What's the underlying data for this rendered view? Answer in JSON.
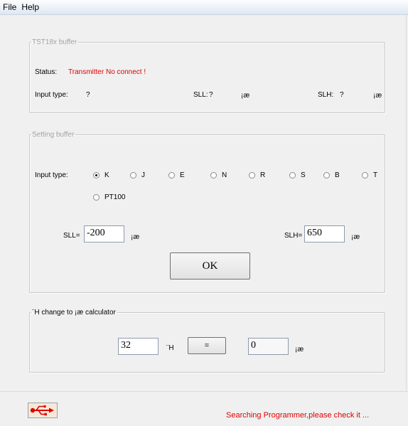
{
  "menu": {
    "file": "File",
    "help": "Help"
  },
  "buffer_group": {
    "legend": "TST18x buffer",
    "status_label": "Status:",
    "status_value": "Transmitter No connect !",
    "input_type_label": "Input type:",
    "input_type_value": "?",
    "sll_label": "SLL:",
    "sll_value": "?",
    "sll_unit": "¡æ",
    "slh_label": "SLH:",
    "slh_value": "?",
    "slh_unit": "¡æ"
  },
  "setting_group": {
    "legend": "Setting buffer",
    "input_type_label": "Input type:",
    "options": [
      "K",
      "J",
      "E",
      "N",
      "R",
      "S",
      "B",
      "T",
      "PT100"
    ],
    "selected": "K",
    "sll_label": "SLL=",
    "sll_value": "-200",
    "sll_unit": "¡æ",
    "slh_label": "SLH=",
    "slh_value": "650",
    "slh_unit": "¡æ",
    "ok_label": "OK"
  },
  "calc_group": {
    "legend": "¨H change to ¡æ calculator",
    "f_value": "32",
    "f_unit": "¨H",
    "eq_label": "=",
    "c_value": "0",
    "c_unit": "¡æ"
  },
  "status_bar": {
    "usb_icon": "usb-icon",
    "message": "Searching Programmer,please check it ...",
    "accent": "#e00000"
  }
}
